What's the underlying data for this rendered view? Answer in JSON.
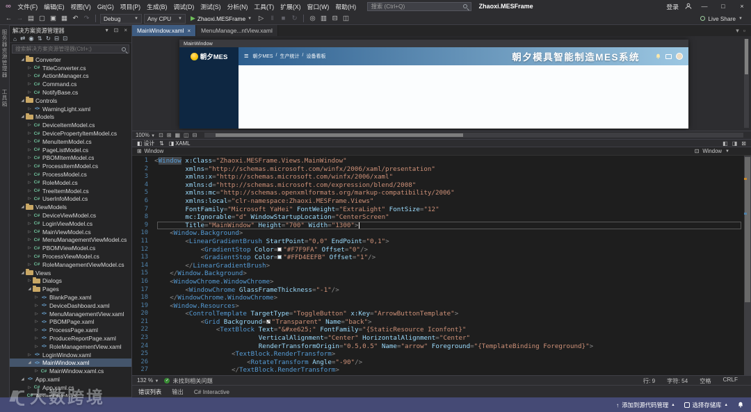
{
  "colors": {
    "chrome": "#2d2d30",
    "panel": "#252526",
    "editor-bg": "#1e1e1e",
    "border": "#3f3f46",
    "tab-active": "#3e5c82",
    "selection": "#44556b",
    "statusbar": "#454a75",
    "navy": "#0e2742",
    "hgrad1": "#2d5e8e",
    "hgrad2": "#9cc7e2",
    "linenum": "#4f81a9",
    "tag": "#569cd6",
    "attr": "#9cdcfe",
    "string": "#ce9178",
    "punct": "#8a8a8a",
    "run-green": "#6fbf5a",
    "health-green": "#388a34"
  },
  "title_bar": {
    "menus": [
      "文件(F)",
      "编辑(E)",
      "视图(V)",
      "Git(G)",
      "项目(P)",
      "生成(B)",
      "调试(D)",
      "测试(S)",
      "分析(N)",
      "工具(T)",
      "扩展(X)",
      "窗口(W)",
      "帮助(H)"
    ],
    "search_placeholder": "搜索 (Ctrl+Q)",
    "app_title": "Zhaoxi.MESFrame",
    "sign_in": "登录"
  },
  "toolbar": {
    "icons_nav": [
      {
        "name": "back-icon",
        "glyph": "←"
      },
      {
        "name": "forward-icon",
        "glyph": "→",
        "disabled": true
      },
      {
        "name": "new-file-icon",
        "glyph": "▤"
      },
      {
        "name": "open-file-icon",
        "glyph": "▢"
      },
      {
        "name": "save-icon",
        "glyph": "▣"
      },
      {
        "name": "save-all-icon",
        "glyph": "▦"
      },
      {
        "name": "undo-icon",
        "glyph": "↶"
      },
      {
        "name": "redo-icon",
        "glyph": "↷",
        "disabled": true
      }
    ],
    "config": "Debug",
    "platform": "Any CPU",
    "run_target": "Zhaoxi.MESFrame",
    "icons_run": [
      {
        "name": "start-without-debugging-icon",
        "glyph": "▷"
      },
      {
        "name": "pause-icon",
        "glyph": "‖",
        "disabled": true
      },
      {
        "name": "stop-icon",
        "glyph": "■",
        "disabled": true
      },
      {
        "name": "restart-icon",
        "glyph": "↻",
        "disabled": true
      }
    ],
    "icons_misc": [
      {
        "name": "find-icon",
        "glyph": "◎"
      },
      {
        "name": "comment-icon",
        "glyph": "▥"
      },
      {
        "name": "bookmark-icon",
        "glyph": "⊟"
      },
      {
        "name": "editor-layout-icon",
        "glyph": "◫"
      }
    ],
    "live_share": "Live Share"
  },
  "edge_tabs": [
    "服务器资源管理器",
    "工具箱"
  ],
  "solution_explorer": {
    "title": "解决方案资源管理器",
    "toolbar_icons": [
      {
        "name": "home-icon",
        "glyph": "⌂"
      },
      {
        "name": "switch-views-icon",
        "glyph": "⇄"
      },
      {
        "name": "pending-changes-icon",
        "glyph": "◉"
      },
      {
        "name": "sync-active-document-icon",
        "glyph": "⇅"
      },
      {
        "name": "refresh-icon",
        "glyph": "↻"
      },
      {
        "name": "collapse-all-icon",
        "glyph": "⊟"
      },
      {
        "name": "properties-icon",
        "glyph": "⊡"
      }
    ],
    "search_placeholder": "搜索解决方案资源管理器(Ctrl+;)",
    "items": [
      {
        "label": "Converter",
        "icon": "folder",
        "depth": 1,
        "arrow": "expanded"
      },
      {
        "label": "TitleConverter.cs",
        "icon": "cs",
        "depth": 2,
        "arrow": "collapsed"
      },
      {
        "label": "ActionManager.cs",
        "icon": "cs",
        "depth": 2,
        "arrow": "collapsed"
      },
      {
        "label": "Command.cs",
        "icon": "cs",
        "depth": 2,
        "arrow": "collapsed"
      },
      {
        "label": "NotifyBase.cs",
        "icon": "cs",
        "depth": 2,
        "arrow": "collapsed"
      },
      {
        "label": "Controls",
        "icon": "folder",
        "depth": 1,
        "arrow": "expanded"
      },
      {
        "label": "WarningLight.xaml",
        "icon": "xaml",
        "depth": 2,
        "arrow": "collapsed"
      },
      {
        "label": "Models",
        "icon": "folder",
        "depth": 1,
        "arrow": "expanded"
      },
      {
        "label": "DeviceItemModel.cs",
        "icon": "cs",
        "depth": 2,
        "arrow": "collapsed"
      },
      {
        "label": "DevicePropertyItemModel.cs",
        "icon": "cs",
        "depth": 2,
        "arrow": "collapsed"
      },
      {
        "label": "MenuItemModel.cs",
        "icon": "cs",
        "depth": 2,
        "arrow": "collapsed"
      },
      {
        "label": "PageListModel.cs",
        "icon": "cs",
        "depth": 2,
        "arrow": "collapsed"
      },
      {
        "label": "PBOMItemModel.cs",
        "icon": "cs",
        "depth": 2,
        "arrow": "collapsed"
      },
      {
        "label": "ProcessItemModel.cs",
        "icon": "cs",
        "depth": 2,
        "arrow": "collapsed"
      },
      {
        "label": "ProcessModel.cs",
        "icon": "cs",
        "depth": 2,
        "arrow": "collapsed"
      },
      {
        "label": "RoleModel.cs",
        "icon": "cs",
        "depth": 2,
        "arrow": "collapsed"
      },
      {
        "label": "TreeItemModel.cs",
        "icon": "cs",
        "depth": 2,
        "arrow": "collapsed"
      },
      {
        "label": "UserInfoModel.cs",
        "icon": "cs",
        "depth": 2,
        "arrow": "collapsed"
      },
      {
        "label": "ViewModels",
        "icon": "folder",
        "depth": 1,
        "arrow": "expanded"
      },
      {
        "label": "DeviceViewModel.cs",
        "icon": "cs",
        "depth": 2,
        "arrow": "collapsed"
      },
      {
        "label": "LoginViewModel.cs",
        "icon": "cs",
        "depth": 2,
        "arrow": "collapsed"
      },
      {
        "label": "MainViewModel.cs",
        "icon": "cs",
        "depth": 2,
        "arrow": "collapsed"
      },
      {
        "label": "MenuManagementViewModel.cs",
        "icon": "cs",
        "depth": 2,
        "arrow": "collapsed"
      },
      {
        "label": "PBOMViewModel.cs",
        "icon": "cs",
        "depth": 2,
        "arrow": "collapsed"
      },
      {
        "label": "ProcessViewModel.cs",
        "icon": "cs",
        "depth": 2,
        "arrow": "collapsed"
      },
      {
        "label": "RoleManagementViewModel.cs",
        "icon": "cs",
        "depth": 2,
        "arrow": "collapsed"
      },
      {
        "label": "Views",
        "icon": "folder",
        "depth": 1,
        "arrow": "expanded"
      },
      {
        "label": "Dialogs",
        "icon": "folder",
        "depth": 2,
        "arrow": "collapsed"
      },
      {
        "label": "Pages",
        "icon": "folder",
        "depth": 2,
        "arrow": "expanded"
      },
      {
        "label": "BlankPage.xaml",
        "icon": "xaml",
        "depth": 3,
        "arrow": "collapsed"
      },
      {
        "label": "DeviceDashboard.xaml",
        "icon": "xaml",
        "depth": 3,
        "arrow": "collapsed"
      },
      {
        "label": "MenuManagementView.xaml",
        "icon": "xaml",
        "depth": 3,
        "arrow": "collapsed"
      },
      {
        "label": "PBOMPage.xaml",
        "icon": "xaml",
        "depth": 3,
        "arrow": "collapsed"
      },
      {
        "label": "ProcessPage.xaml",
        "icon": "xaml",
        "depth": 3,
        "arrow": "collapsed"
      },
      {
        "label": "ProduceReportPage.xaml",
        "icon": "xaml",
        "depth": 3,
        "arrow": "collapsed"
      },
      {
        "label": "RoleManagementView.xaml",
        "icon": "xaml",
        "depth": 3,
        "arrow": "collapsed"
      },
      {
        "label": "LoginWindow.xaml",
        "icon": "xaml",
        "depth": 2,
        "arrow": "collapsed"
      },
      {
        "label": "MainWindow.xaml",
        "icon": "xaml",
        "depth": 2,
        "arrow": "expanded",
        "selected": true
      },
      {
        "label": "MainWindow.xaml.cs",
        "icon": "cs",
        "depth": 3,
        "arrow": "collapsed"
      },
      {
        "label": "App.xaml",
        "icon": "xaml",
        "depth": 1,
        "arrow": "expanded"
      },
      {
        "label": "App.xaml.cs",
        "icon": "cs",
        "depth": 2,
        "arrow": "collapsed"
      },
      {
        "label": "AssemblyInfo.cs",
        "icon": "cs",
        "depth": 1,
        "arrow": "none"
      }
    ]
  },
  "editor": {
    "tabs": [
      {
        "label": "MainWindow.xaml",
        "active": true
      },
      {
        "label": "MenuManage...ntView.xaml",
        "active": false
      }
    ],
    "designer": {
      "window_title": "MainWindow",
      "logo": "朝夕MES",
      "nav": [
        "朝夕MES",
        "生产统计",
        "设备看板"
      ],
      "header_title": "朝夕模具智能制造MES系统",
      "zoom": "100%",
      "toolbar_icons": [
        {
          "name": "zoom-fit-icon",
          "glyph": "⊡"
        },
        {
          "name": "grid-toggle-icon",
          "glyph": "⊞"
        },
        {
          "name": "snap-grid-icon",
          "glyph": "▦"
        },
        {
          "name": "snaplines-icon",
          "glyph": "◫"
        },
        {
          "name": "disable-project-code-icon",
          "glyph": "⊟"
        }
      ]
    },
    "split": {
      "design": "设计",
      "xaml": "XAML"
    },
    "split_icons": [
      {
        "name": "vertical-split-icon",
        "glyph": "◧"
      },
      {
        "name": "horizontal-split-icon",
        "glyph": "◨"
      },
      {
        "name": "expand-pane-icon",
        "glyph": "⊠"
      }
    ],
    "breadcrumb_left": "Window",
    "breadcrumb_right": "Window",
    "current_line": 9,
    "code_lines": [
      "<Window x:Class=\"Zhaoxi.MESFrame.Views.MainWindow\"",
      "        xmlns=\"http://schemas.microsoft.com/winfx/2006/xaml/presentation\"",
      "        xmlns:x=\"http://schemas.microsoft.com/winfx/2006/xaml\"",
      "        xmlns:d=\"http://schemas.microsoft.com/expression/blend/2008\"",
      "        xmlns:mc=\"http://schemas.openxmlformats.org/markup-compatibility/2006\"",
      "        xmlns:local=\"clr-namespace:Zhaoxi.MESFrame.Views\"",
      "        FontFamily=\"Microsoft YaHei\" FontWeight=\"ExtraLight\" FontSize=\"12\"",
      "        mc:Ignorable=\"d\" WindowStartupLocation=\"CenterScreen\"",
      "        Title=\"MainWindow\" Height=\"700\" Width=\"1300\">",
      "    <Window.Background>",
      "        <LinearGradientBrush StartPoint=\"0,0\" EndPoint=\"0,1\">",
      "            <GradientStop Color=\"#F7F9FA\" Offset=\"0\"/>",
      "            <GradientStop Color=\"#FFD4EEFB\" Offset=\"1\"/>",
      "        </LinearGradientBrush>",
      "    </Window.Background>",
      "    <WindowChrome.WindowChrome>",
      "        <WindowChrome GlassFrameThickness=\"-1\"/>",
      "    </WindowChrome.WindowChrome>",
      "    <Window.Resources>",
      "        <ControlTemplate TargetType=\"ToggleButton\" x:Key=\"ArrowButtonTemplate\">",
      "            <Grid Background=\"Transparent\" Name=\"back\">",
      "                <TextBlock Text=\"&#xe625;\" FontFamily=\"{StaticResource Iconfont}\"",
      "                           VerticalAlignment=\"Center\" HorizontalAlignment=\"Center\"",
      "                           RenderTransformOrigin=\"0.5,0.5\" Name=\"arrow\" Foreground=\"{TemplateBinding Foreground}\">",
      "                    <TextBlock.RenderTransform>",
      "                        <RotateTransform Angle=\"-90\"/>",
      "                    </TextBlock.RenderTransform>"
    ],
    "status": {
      "zoom": "132 %",
      "health": "未找到相关问题",
      "line": "行: 9",
      "char": "字符: 54",
      "indent": "空格",
      "eol": "CRLF"
    }
  },
  "bottom_panel": {
    "tabs": [
      "错误列表",
      "输出",
      "C# Interactive"
    ]
  },
  "status_bar": {
    "source_control": "添加到源代码管理",
    "repo_picker": "选择存储库"
  },
  "watermark": "大数跨境"
}
